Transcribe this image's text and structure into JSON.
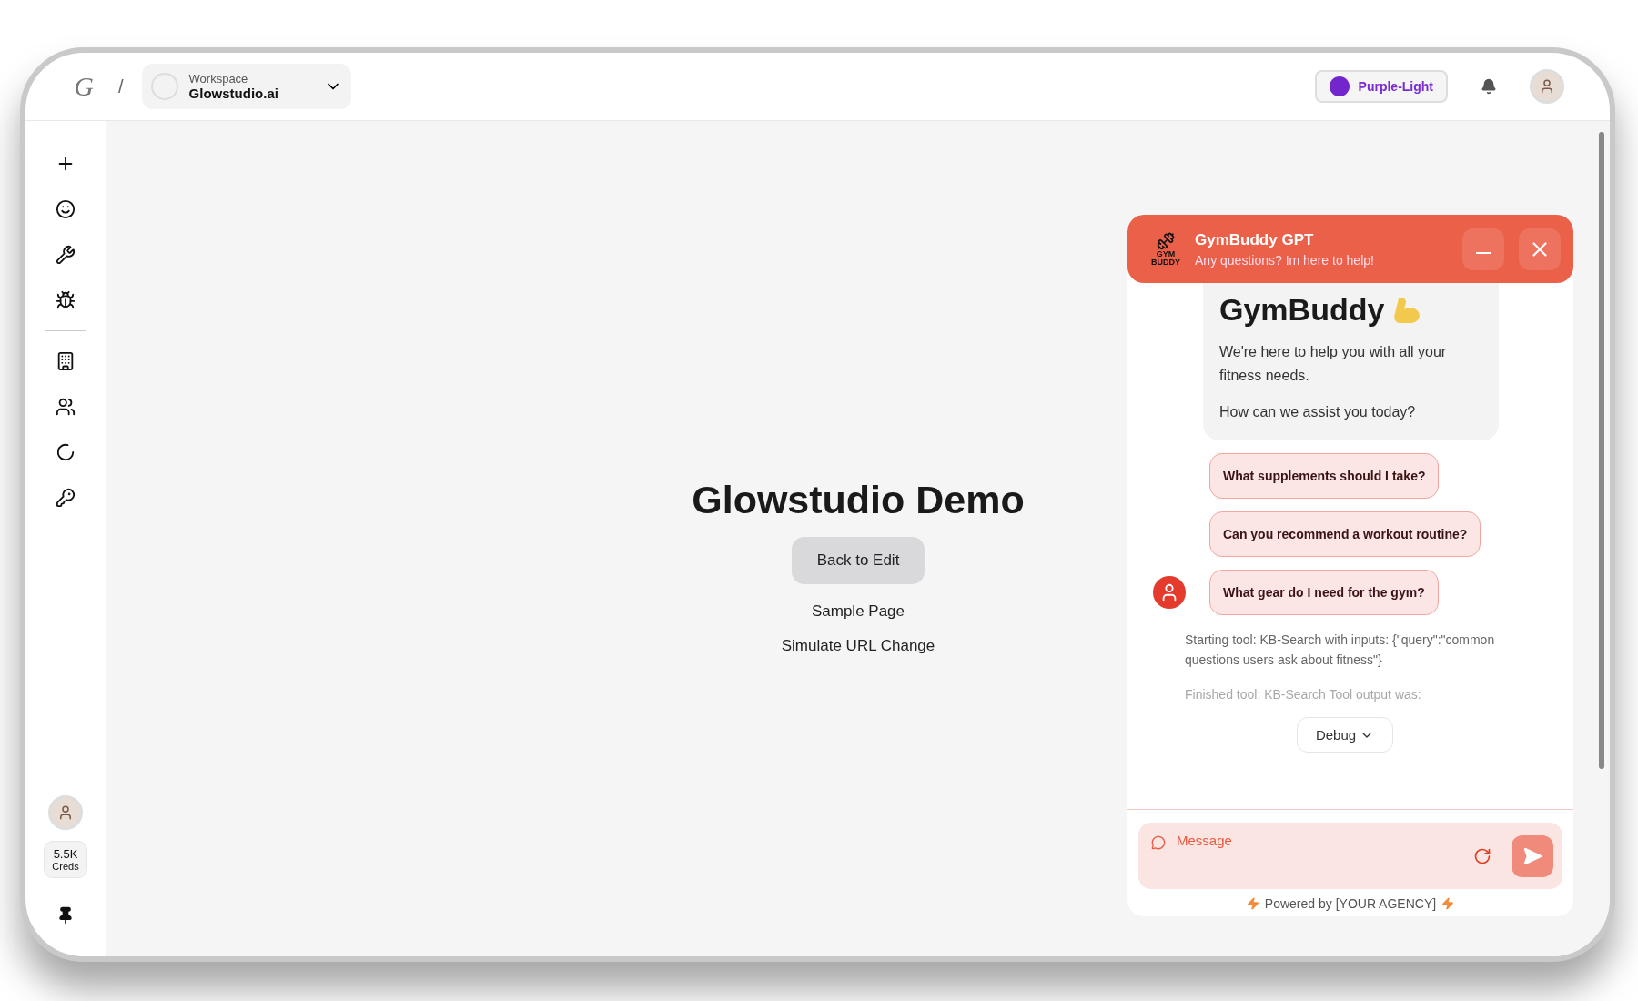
{
  "top_bar": {
    "logo": "G",
    "separator": "/",
    "workspace": {
      "label": "Workspace",
      "name": "Glowstudio.ai"
    },
    "theme_button": "Purple-Light"
  },
  "sidebar": {
    "credits": {
      "amount": "5.5K",
      "label": "Creds"
    }
  },
  "page": {
    "title": "Glowstudio Demo",
    "button": "Back to Edit",
    "subtitle": "Sample Page",
    "link": "Simulate URL Change"
  },
  "chat": {
    "logo_lines": [
      "GYM",
      "BUDDY"
    ],
    "title": "GymBuddy GPT",
    "subtitle": "Any questions? Im here to help!",
    "welcome": {
      "heading": "GymBuddy",
      "body": [
        "We're here to help you with all your fitness needs.",
        "How can we assist you today?"
      ]
    },
    "suggestions": [
      "What supplements should I take?",
      "Can you recommend a workout routine?",
      "What gear do I need for the gym?"
    ],
    "debug_log": [
      {
        "text": "Starting tool: KB-Search with inputs: {\"query\":\"common questions users ask about fitness\"}",
        "faded": false
      },
      {
        "text": "Finished tool: KB-Search Tool output was:",
        "faded": true
      }
    ],
    "debug_button": "Debug",
    "input": {
      "placeholder": "Message"
    },
    "footer": "Powered by [YOUR AGENCY]"
  }
}
